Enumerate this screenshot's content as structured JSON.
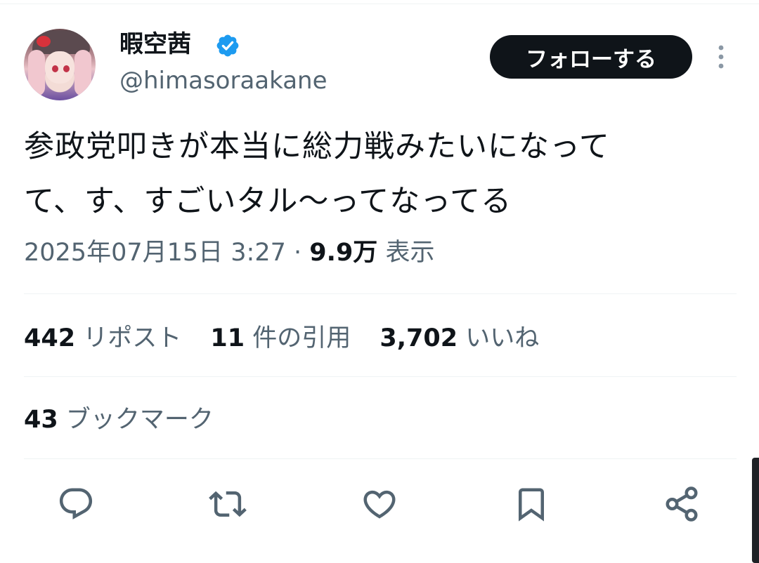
{
  "user": {
    "display_name": "暇空茜",
    "handle": "@himasoraakane",
    "verified": true
  },
  "follow_button": {
    "label": "フォローする"
  },
  "tweet": {
    "text": "参政党叩きが本当に総力戦みたいになって\nて、す、すごいタル〜ってなってる",
    "timestamp": "2025年07月15日 3:27",
    "separator": "·",
    "views_count": "9.9万",
    "views_label": "表示"
  },
  "stats": {
    "reposts": {
      "count": "442",
      "label": "リポスト"
    },
    "quotes": {
      "count": "11",
      "label": "件の引用"
    },
    "likes": {
      "count": "3,702",
      "label": "いいね"
    },
    "bookmarks": {
      "count": "43",
      "label": "ブックマーク"
    }
  },
  "actions": [
    "reply-icon",
    "repost-icon",
    "like-icon",
    "bookmark-icon",
    "share-icon"
  ],
  "colors": {
    "text_primary": "#0f1419",
    "text_secondary": "#536471",
    "verified_blue": "#1d9bf0",
    "divider": "#eff3f4",
    "button_bg": "#0f1419"
  }
}
